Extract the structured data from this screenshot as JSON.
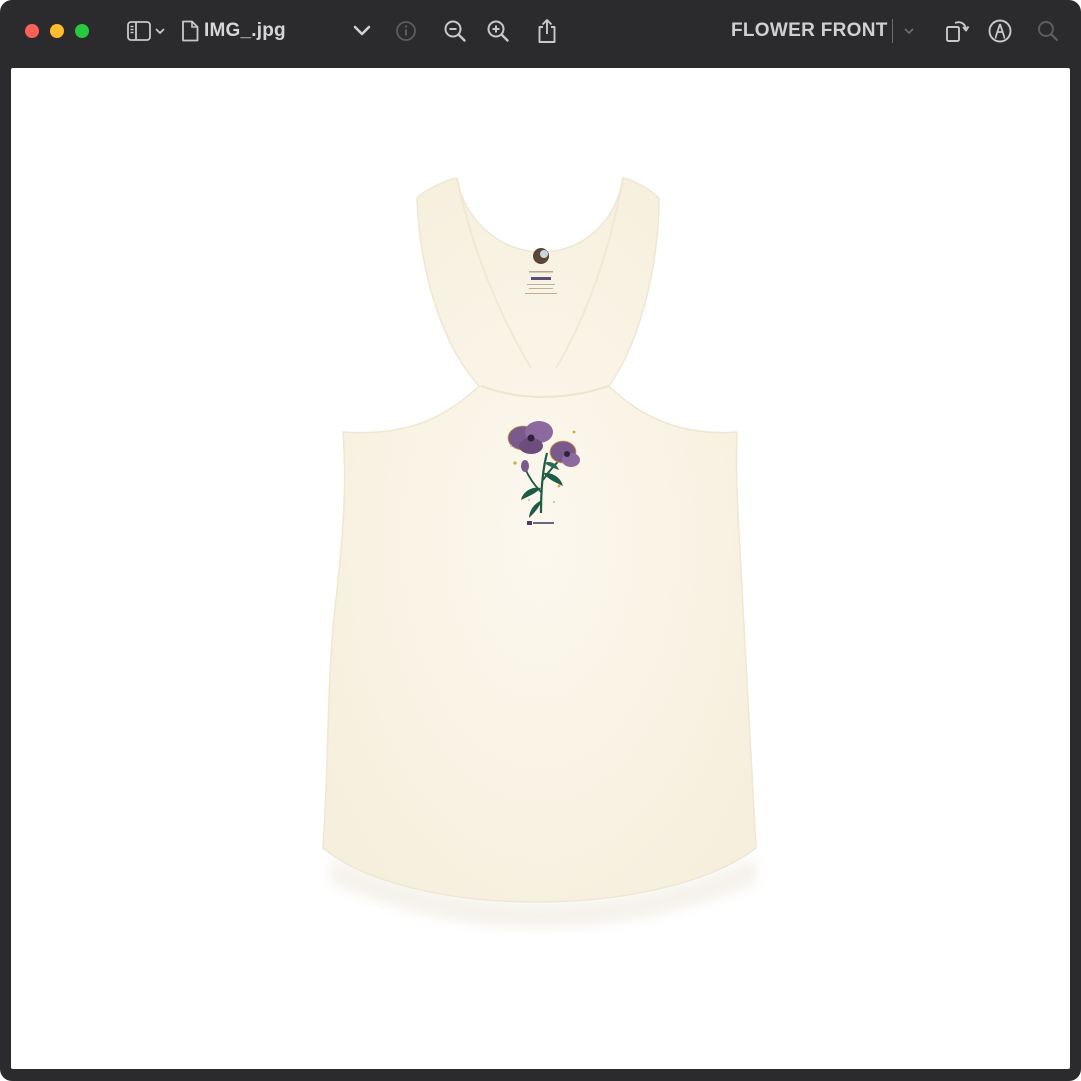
{
  "window": {
    "title": "IMG_.jpg",
    "stamp_label": "FLOWER FRONT"
  },
  "toolbar": {
    "icons": [
      "sidebar-icon",
      "chevron-down-icon",
      "document-icon",
      "chevron-down-icon",
      "info-icon",
      "zoom-out-icon",
      "zoom-in-icon",
      "share-icon",
      "chevron-down-icon",
      "rotate-icon",
      "markup-icon",
      "search-icon"
    ]
  },
  "image": {
    "subject": "tank-top",
    "colors": {
      "shirt": "#fbf6ea",
      "petal": "#7a5a8c",
      "stem": "#1f5a45",
      "accent": "#d4a93b"
    },
    "brand_tag": "Z_SHOPPED"
  }
}
